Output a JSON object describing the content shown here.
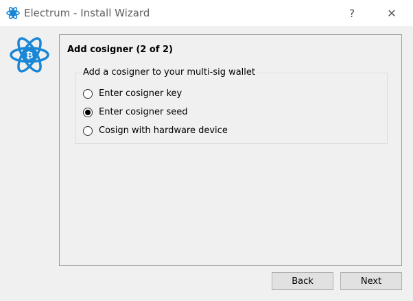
{
  "window": {
    "title": "Electrum  -  Install Wizard",
    "help_glyph": "?",
    "close_glyph": "✕"
  },
  "panel": {
    "title": "Add cosigner (2 of 2)",
    "group_title": "Add a cosigner to your multi-sig wallet",
    "options": [
      {
        "label": "Enter cosigner key",
        "checked": false
      },
      {
        "label": "Enter cosigner seed",
        "checked": true
      },
      {
        "label": "Cosign with hardware device",
        "checked": false
      }
    ]
  },
  "footer": {
    "back_label": "Back",
    "next_label": "Next"
  },
  "colors": {
    "logo_blue": "#1a87d6",
    "background": "#f0f0f0"
  }
}
